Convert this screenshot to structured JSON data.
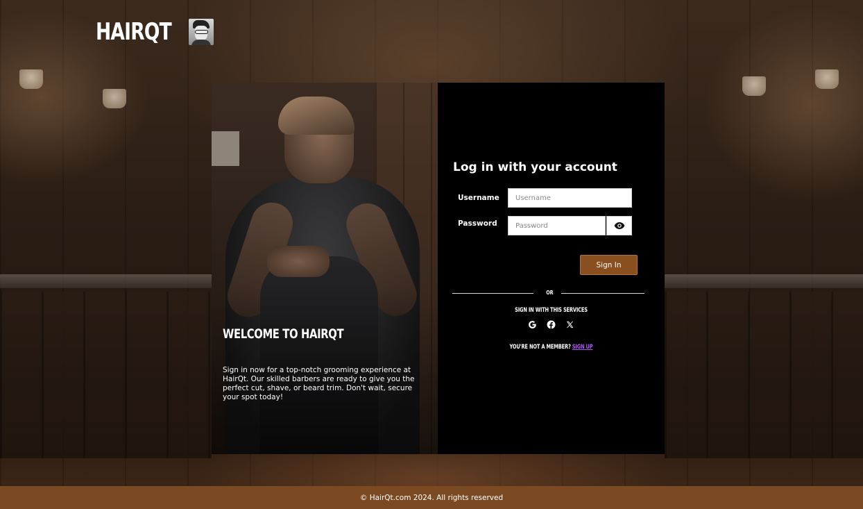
{
  "brand": {
    "name": "HAIRQT"
  },
  "hero": {
    "title": "WELCOME TO HAIRQT",
    "text": "Sign in now for a top-notch grooming experience at HairQt. Our skilled barbers are ready to give you the perfect cut, shave, or beard trim. Don't wait, secure your spot today!"
  },
  "login": {
    "title": "Log in with your account",
    "username_label": "Username",
    "username_placeholder": "Username",
    "username_value": "",
    "password_label": "Password",
    "password_placeholder": "Password",
    "password_value": "",
    "password_toggle_icon": "eye-icon",
    "sign_in_label": "Sign In",
    "sign_in_color": "#8a4f1f"
  },
  "alt_login": {
    "or_label": "OR",
    "services_label": "SIGN IN WITH THIS SERVICES",
    "services": [
      {
        "name": "google",
        "icon": "google-icon"
      },
      {
        "name": "facebook",
        "icon": "facebook-icon"
      },
      {
        "name": "x",
        "icon": "x-icon"
      }
    ],
    "member_prompt": "YOU'RE NOT A MEMBER?",
    "signup_label": "SIGN UP",
    "signup_color": "#b055f0"
  },
  "footer": {
    "text": "© HairQt.com 2024. All rights reserved",
    "background": "#7b4a22"
  }
}
